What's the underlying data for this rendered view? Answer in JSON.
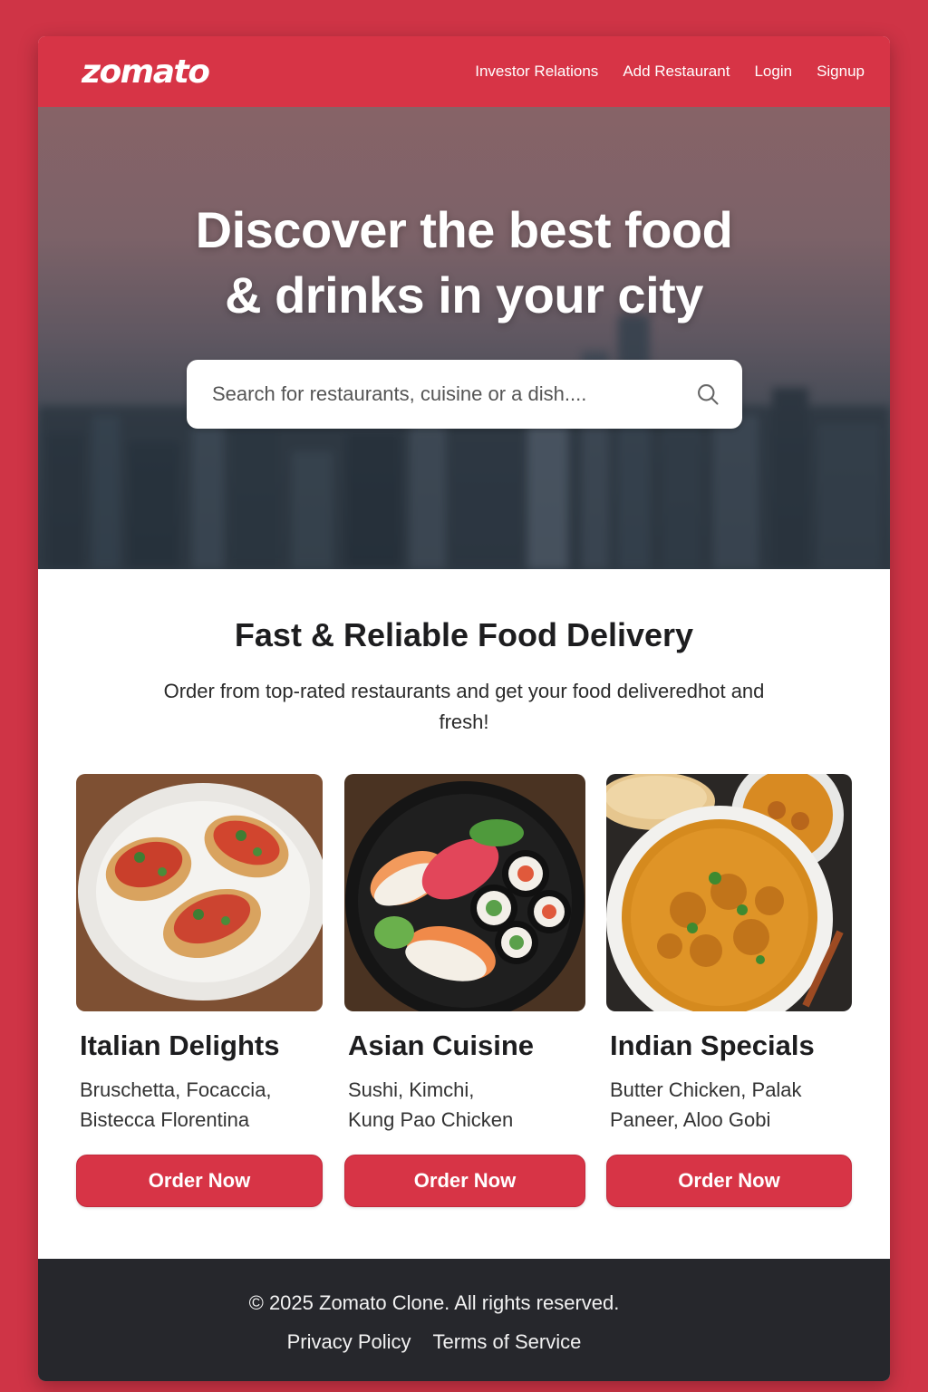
{
  "brand": {
    "logo_text": "zomato",
    "accent_color": "#d73446"
  },
  "nav": {
    "links": [
      "Investor Relations",
      "Add Restaurant",
      "Login",
      "Signup"
    ]
  },
  "hero": {
    "title_line1": "Discover the best food",
    "title_line2": "& drinks in your city",
    "search_placeholder": "Search for restaurants, cuisine or a dish....",
    "search_icon": "search-icon"
  },
  "section": {
    "title": "Fast & Reliable Food Delivery",
    "subtitle": "Order from top-rated restaurants and get your food deliveredhot and fresh!"
  },
  "cards": [
    {
      "title": "Italian Delights",
      "desc_line1": "Bruschetta, Focaccia,",
      "desc_line2": "Bistecca Florentina",
      "button": "Order Now",
      "image": "bruschetta-plate"
    },
    {
      "title": "Asian Cuisine",
      "desc_line1": "Sushi, Kimchi,",
      "desc_line2": "Kung Pao Chicken",
      "button": "Order Now",
      "image": "sushi-bowl"
    },
    {
      "title": "Indian Specials",
      "desc_line1": "Butter Chicken, Palak",
      "desc_line2": "Paneer, Aloo Gobi",
      "button": "Order Now",
      "image": "curry-bowl"
    }
  ],
  "footer": {
    "copyright": "© 2025 Zomato Clone. All rights reserved.",
    "links": [
      "Privacy Policy",
      "Terms of Service"
    ]
  }
}
